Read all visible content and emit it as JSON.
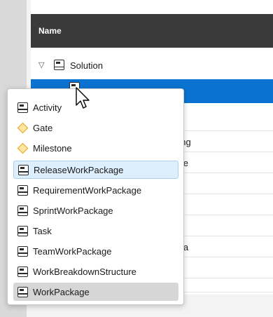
{
  "table": {
    "header": "Name",
    "solution_label": "Solution",
    "row_fragments": [
      "rolling",
      "ype",
      "ata"
    ]
  },
  "menu": {
    "items": [
      {
        "label": "Activity",
        "icon": "work-package-icon"
      },
      {
        "label": "Gate",
        "icon": "gate-icon"
      },
      {
        "label": "Milestone",
        "icon": "milestone-icon"
      },
      {
        "label": "ReleaseWorkPackage",
        "icon": "work-package-icon",
        "state": "hovered"
      },
      {
        "label": "RequirementWorkPackage",
        "icon": "work-package-icon"
      },
      {
        "label": "SprintWorkPackage",
        "icon": "work-package-icon"
      },
      {
        "label": "Task",
        "icon": "work-package-icon"
      },
      {
        "label": "TeamWorkPackage",
        "icon": "work-package-icon"
      },
      {
        "label": "WorkBreakdownStructure",
        "icon": "work-package-icon"
      },
      {
        "label": "WorkPackage",
        "icon": "work-package-icon",
        "state": "pressed"
      }
    ]
  },
  "colors": {
    "selection": "#0a73d1",
    "hover": "#ddeefc",
    "gate": "#e8a21a",
    "header": "#3a3a3a"
  }
}
